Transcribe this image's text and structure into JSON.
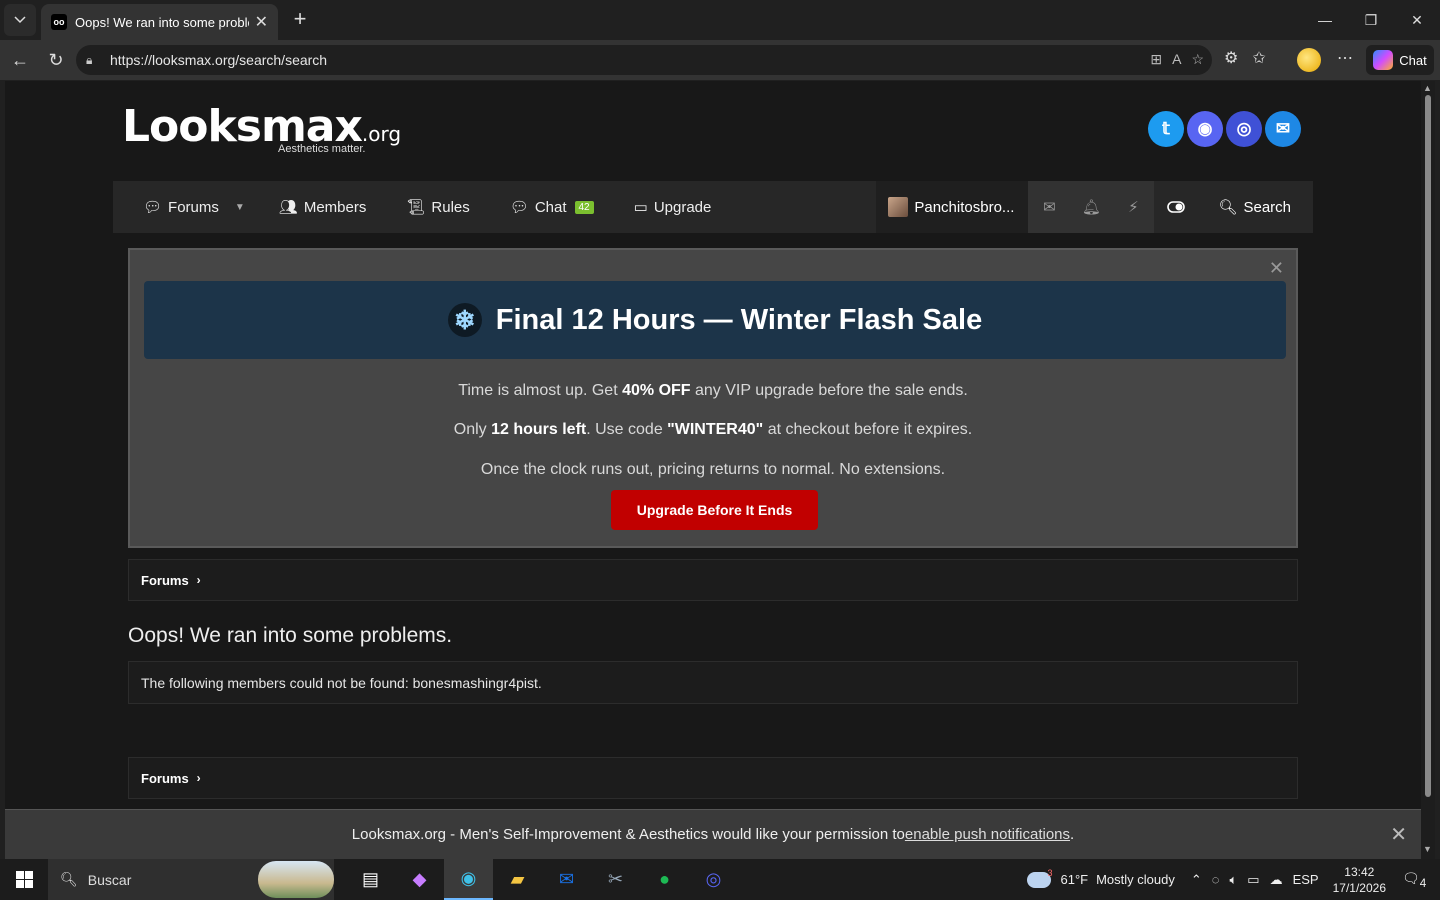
{
  "browser": {
    "tab_title": "Oops! We ran into some problems.",
    "favicon_text": "oo",
    "url": "https://looksmax.org/search/search",
    "chat_label": "Chat"
  },
  "site": {
    "logo_main": "Looksmax",
    "logo_tld": ".org",
    "tagline": "Aesthetics matter.",
    "social_colors": {
      "twitter": "#1d9bf0",
      "discord": "#5865f2",
      "instagram": "#3f51d6",
      "email": "#1e88e5"
    }
  },
  "nav": {
    "forums": "Forums",
    "members": "Members",
    "rules": "Rules",
    "chat": "Chat",
    "chat_badge": "42",
    "upgrade": "Upgrade",
    "username": "Panchitosbro...",
    "search": "Search"
  },
  "promo": {
    "headline": "Final 12 Hours — Winter Flash Sale",
    "line1_pre": "Time is almost up. Get ",
    "line1_bold": "40% OFF",
    "line1_post": " any VIP upgrade before the sale ends.",
    "line2_pre": "Only ",
    "line2_bold": "12 hours left",
    "line2_mid": ". Use code ",
    "line2_code": "\"WINTER40\"",
    "line2_post": " at checkout before it expires.",
    "line3": "Once the clock runs out, pricing returns to normal. No extensions.",
    "cta": "Upgrade Before It Ends"
  },
  "breadcrumb": {
    "label": "Forums"
  },
  "error": {
    "title": "Oops! We ran into some problems.",
    "message": "The following members could not be found: bonesmashingr4pist."
  },
  "push": {
    "text": "Looksmax.org - Men's Self-Improvement & Aesthetics would like your permission to ",
    "link": "enable push notifications",
    "suffix": "."
  },
  "taskbar": {
    "search_placeholder": "Buscar",
    "weather_temp": "61°F",
    "weather_desc": "Mostly cloudy",
    "weather_badge": "3",
    "lang": "ESP",
    "time": "13:42",
    "date": "17/1/2026",
    "notif_count": "4"
  }
}
